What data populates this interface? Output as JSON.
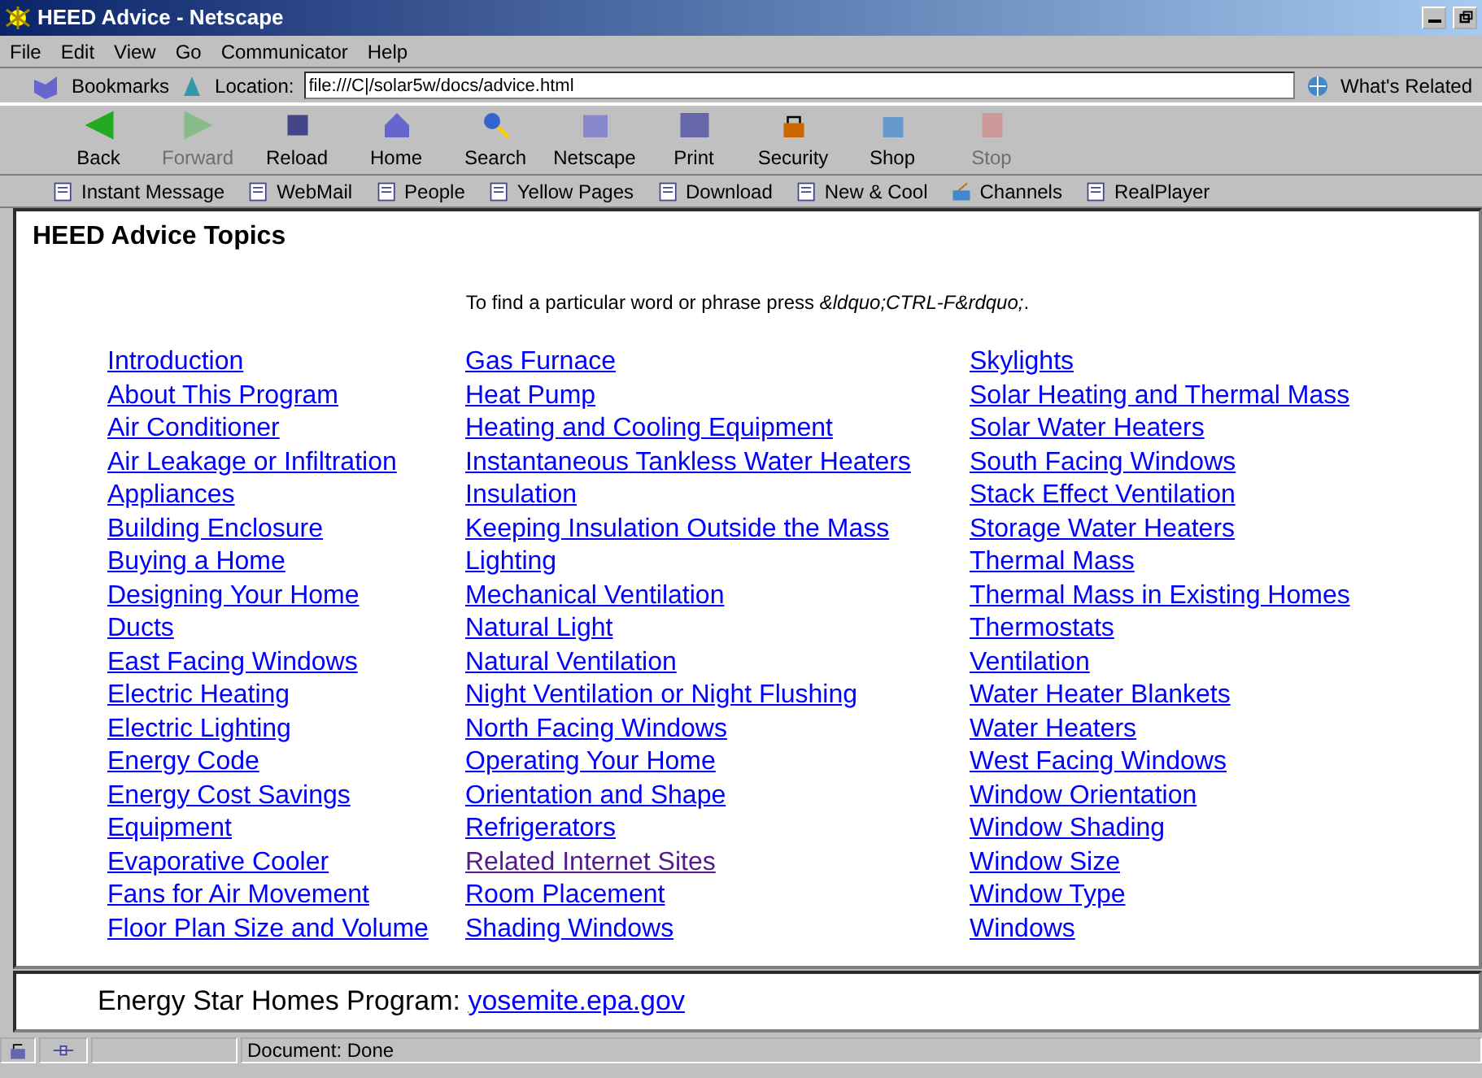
{
  "window": {
    "title": "HEED Advice - Netscape"
  },
  "menu": [
    "File",
    "Edit",
    "View",
    "Go",
    "Communicator",
    "Help"
  ],
  "location_bar": {
    "bookmarks": "Bookmarks",
    "label": "Location:",
    "url": "file:///C|/solar5w/docs/advice.html",
    "related": "What's Related"
  },
  "nav_buttons": [
    {
      "label": "Back",
      "disabled": false
    },
    {
      "label": "Forward",
      "disabled": true
    },
    {
      "label": "Reload",
      "disabled": false
    },
    {
      "label": "Home",
      "disabled": false
    },
    {
      "label": "Search",
      "disabled": false
    },
    {
      "label": "Netscape",
      "disabled": false
    },
    {
      "label": "Print",
      "disabled": false
    },
    {
      "label": "Security",
      "disabled": false
    },
    {
      "label": "Shop",
      "disabled": false
    },
    {
      "label": "Stop",
      "disabled": true
    }
  ],
  "personal_bar": [
    {
      "label": "Instant Message",
      "kind": "bookmark"
    },
    {
      "label": "WebMail",
      "kind": "bookmark"
    },
    {
      "label": "People",
      "kind": "bookmark"
    },
    {
      "label": "Yellow Pages",
      "kind": "bookmark"
    },
    {
      "label": "Download",
      "kind": "bookmark"
    },
    {
      "label": "New & Cool",
      "kind": "bookmark"
    },
    {
      "label": "Channels",
      "kind": "channels"
    },
    {
      "label": "RealPlayer",
      "kind": "bookmark"
    }
  ],
  "page": {
    "heading": "HEED Advice Topics",
    "hint": "To find a particular word or phrase press *&ldquo;CTRL-F&rdquo;*.",
    "columns": [
      [
        {
          "label": "Introduction",
          "visited": false
        },
        {
          "label": "About This Program",
          "visited": false
        },
        {
          "label": "Air Conditioner",
          "visited": false
        },
        {
          "label": "Air Leakage or Infiltration",
          "visited": false
        },
        {
          "label": "Appliances",
          "visited": false
        },
        {
          "label": "Building Enclosure",
          "visited": false
        },
        {
          "label": "Buying a Home",
          "visited": false
        },
        {
          "label": "Designing Your Home",
          "visited": false
        },
        {
          "label": "Ducts",
          "visited": false
        },
        {
          "label": "East Facing Windows",
          "visited": false
        },
        {
          "label": "Electric Heating",
          "visited": false
        },
        {
          "label": "Electric Lighting",
          "visited": false
        },
        {
          "label": "Energy Code",
          "visited": false
        },
        {
          "label": "Energy Cost Savings",
          "visited": false
        },
        {
          "label": "Equipment",
          "visited": false
        },
        {
          "label": "Evaporative Cooler",
          "visited": false
        },
        {
          "label": "Fans for Air Movement",
          "visited": false
        },
        {
          "label": "Floor Plan Size and Volume",
          "visited": false
        }
      ],
      [
        {
          "label": "Gas Furnace",
          "visited": false
        },
        {
          "label": "Heat Pump",
          "visited": false
        },
        {
          "label": "Heating and Cooling Equipment",
          "visited": false
        },
        {
          "label": "Instantaneous Tankless Water Heaters",
          "visited": false
        },
        {
          "label": "Insulation",
          "visited": false
        },
        {
          "label": "Keeping Insulation Outside the Mass",
          "visited": false
        },
        {
          "label": "Lighting",
          "visited": false
        },
        {
          "label": "Mechanical Ventilation",
          "visited": false
        },
        {
          "label": "Natural Light",
          "visited": false
        },
        {
          "label": "Natural Ventilation",
          "visited": false
        },
        {
          "label": "Night Ventilation or Night Flushing",
          "visited": false
        },
        {
          "label": "North Facing Windows",
          "visited": false
        },
        {
          "label": "Operating Your Home",
          "visited": false
        },
        {
          "label": "Orientation and Shape",
          "visited": false
        },
        {
          "label": "Refrigerators",
          "visited": false
        },
        {
          "label": "Related Internet Sites",
          "visited": true
        },
        {
          "label": "Room Placement",
          "visited": false
        },
        {
          "label": "Shading Windows",
          "visited": false
        }
      ],
      [
        {
          "label": "Skylights",
          "visited": false
        },
        {
          "label": "Solar Heating and Thermal Mass",
          "visited": false
        },
        {
          "label": "Solar Water Heaters",
          "visited": false
        },
        {
          "label": "South Facing Windows",
          "visited": false
        },
        {
          "label": "Stack Effect Ventilation",
          "visited": false
        },
        {
          "label": "Storage Water Heaters",
          "visited": false
        },
        {
          "label": "Thermal Mass",
          "visited": false
        },
        {
          "label": "Thermal Mass in Existing Homes",
          "visited": false
        },
        {
          "label": "Thermostats",
          "visited": false
        },
        {
          "label": "Ventilation",
          "visited": false
        },
        {
          "label": "Water Heater Blankets",
          "visited": false
        },
        {
          "label": "Water Heaters",
          "visited": false
        },
        {
          "label": "West Facing Windows",
          "visited": false
        },
        {
          "label": "Window Orientation",
          "visited": false
        },
        {
          "label": "Window Shading",
          "visited": false
        },
        {
          "label": "Window Size",
          "visited": false
        },
        {
          "label": "Window Type",
          "visited": false
        },
        {
          "label": "Windows",
          "visited": false
        }
      ]
    ]
  },
  "lower_frame": {
    "label": "Energy Star Homes Program:",
    "link": "yosemite.epa.gov"
  },
  "status_bar": {
    "text": "Document: Done"
  }
}
